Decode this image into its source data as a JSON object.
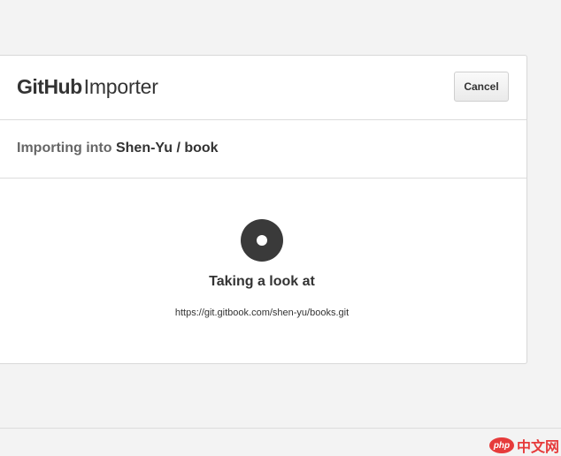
{
  "header": {
    "logo_bold": "GitHub",
    "logo_light": "Importer",
    "cancel_label": "Cancel"
  },
  "subheader": {
    "prefix": "Importing into ",
    "owner": "Shen-Yu",
    "separator": " / ",
    "repo": "book"
  },
  "status": {
    "spinner_icon": "spinner-icon",
    "title": "Taking a look at",
    "url": "https://git.gitbook.com/shen-yu/books.git"
  },
  "watermark": {
    "badge": "php",
    "text": "中文网"
  },
  "colors": {
    "background": "#f3f3f3",
    "card": "#ffffff",
    "spinner": "#3a3a3a",
    "watermark": "#e63b3b"
  }
}
